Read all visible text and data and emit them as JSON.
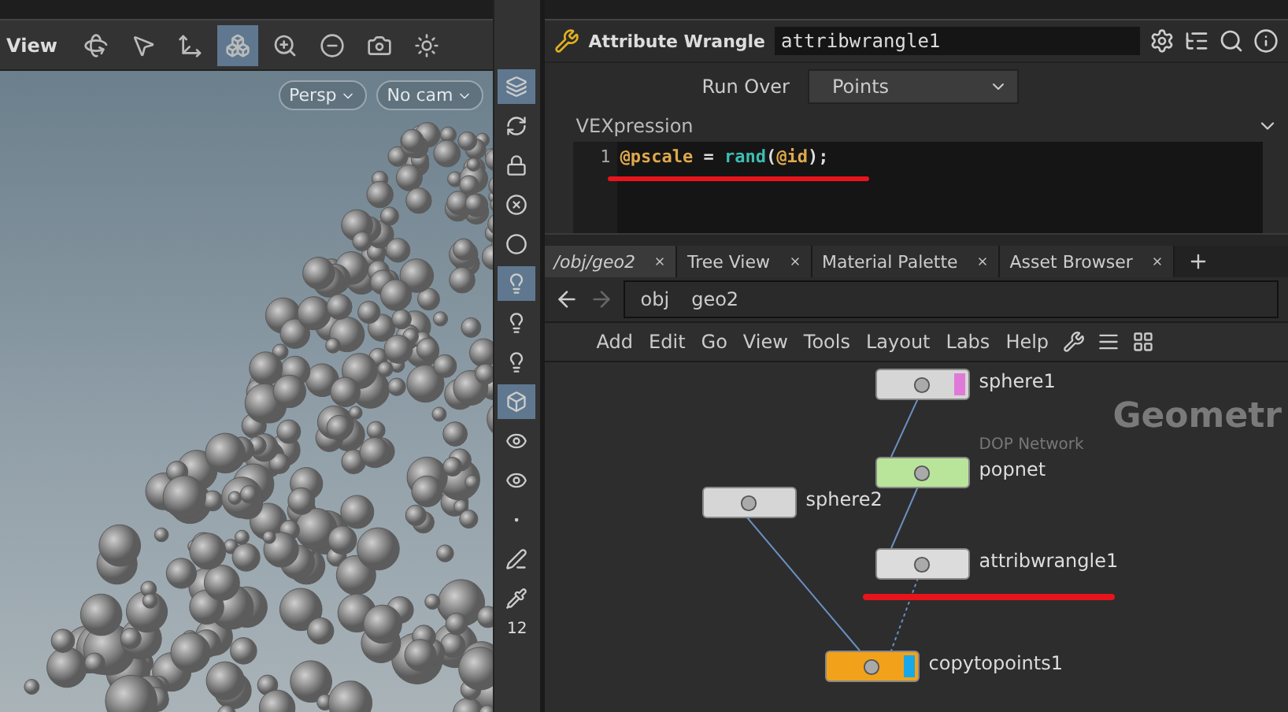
{
  "viewport": {
    "title": "View",
    "toolbar_buttons": [
      {
        "active": false
      },
      {
        "active": false
      },
      {
        "active": false
      },
      {
        "active": true
      },
      {
        "active": false
      },
      {
        "active": false
      },
      {
        "active": false
      },
      {
        "active": false
      }
    ],
    "camera_menus": [
      "Persp",
      "No cam"
    ],
    "side_buttons": [
      {
        "active": true
      },
      {
        "active": false
      },
      {
        "active": false
      },
      {
        "active": false
      },
      {
        "active": false
      },
      {
        "active": true
      },
      {
        "active": false
      },
      {
        "active": false
      },
      {
        "active": true
      },
      {
        "active": false
      },
      {
        "active": false
      },
      {
        "active": false
      },
      {
        "active": false
      },
      {
        "active": false
      }
    ],
    "point_count": "12"
  },
  "parameters": {
    "node_type": "Attribute Wrangle",
    "node_name": "attribwrangle1",
    "run_over": {
      "label": "Run Over",
      "value": "Points"
    },
    "code_label": "VEXpression",
    "code": {
      "line_number": "1",
      "tokens": [
        {
          "kind": "attribute",
          "text": "@pscale"
        },
        {
          "kind": "plain",
          "text": " = "
        },
        {
          "kind": "function",
          "text": "rand"
        },
        {
          "kind": "plain",
          "text": "("
        },
        {
          "kind": "attribute",
          "text": "@id"
        },
        {
          "kind": "plain",
          "text": ");"
        }
      ]
    }
  },
  "tabs": [
    {
      "label": "/obj/geo2",
      "selected": true
    },
    {
      "label": "Tree View",
      "selected": false
    },
    {
      "label": "Material Palette",
      "selected": false
    },
    {
      "label": "Asset Browser",
      "selected": false
    }
  ],
  "path": [
    "obj",
    "geo2"
  ],
  "menu": [
    "Add",
    "Edit",
    "Go",
    "View",
    "Tools",
    "Layout",
    "Labs",
    "Help"
  ],
  "network": {
    "context_label": "Geometr",
    "nodes": [
      {
        "name": "sphere1",
        "kind": "sop",
        "template": true,
        "display": false
      },
      {
        "name": "popnet",
        "kind": "dop",
        "subtitle": "DOP Network",
        "template": false,
        "display": false
      },
      {
        "name": "sphere2",
        "kind": "sop",
        "template": false,
        "display": false
      },
      {
        "name": "attribwrangle1",
        "kind": "wrangle",
        "template": false,
        "display": false
      },
      {
        "name": "copytopoints1",
        "kind": "copy",
        "template": false,
        "display": true
      }
    ]
  }
}
